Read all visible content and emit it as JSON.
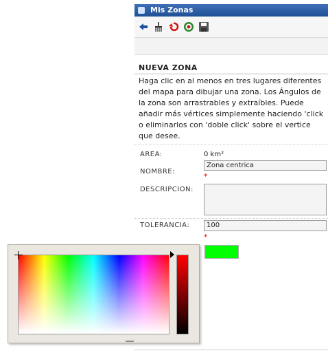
{
  "window": {
    "title": "Mis Zonas"
  },
  "toolbar": {
    "buttons": [
      {
        "icon": "back-arrow-icon"
      },
      {
        "icon": "broom-icon"
      },
      {
        "icon": "undo-icon"
      },
      {
        "icon": "target-icon"
      },
      {
        "icon": "save-icon"
      }
    ]
  },
  "section": {
    "heading": "NUEVA ZONA",
    "instructions": [
      "Haga clic en al menos en tres lugares diferentes",
      "del mapa para dibujar una zona. Los Ángulos de",
      "la zona son arrastrables y extraíbles. Puede",
      "añadir más vértices simplemente haciendo 'click",
      "o eliminarlos con 'doble click' sobre el vertice",
      "que desee."
    ]
  },
  "form": {
    "area": {
      "label": "AREA:",
      "value": "0 km²"
    },
    "nombre": {
      "label": "NOMBRE:",
      "value": "Zona centrica",
      "required": "*"
    },
    "descripcion": {
      "label": "DESCRIPCION:",
      "value": ""
    },
    "tolerancia": {
      "label": "TOLERANCIA:",
      "value": "100",
      "required": "*"
    },
    "color": {
      "value": "#00ff00"
    }
  },
  "colors": {
    "titlebar": "#2a5aa3",
    "selected_color": "#00ff00",
    "required": "#dd0000"
  }
}
